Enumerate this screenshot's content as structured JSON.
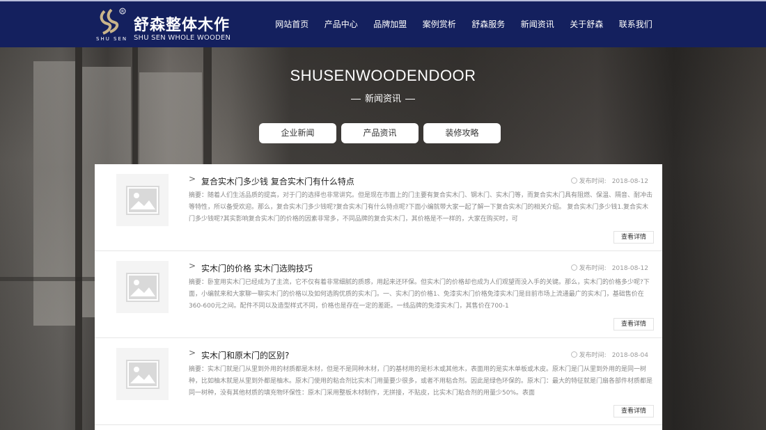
{
  "header": {
    "logo_cn": "舒森整体木作",
    "logo_en": "SHU SEN WHOLE WOODEN",
    "logo_mark_text": "SHU   SEN",
    "nav": [
      "网站首页",
      "产品中心",
      "品牌加盟",
      "案例赏析",
      "舒森服务",
      "新闻资讯",
      "关于舒森",
      "联系我们"
    ]
  },
  "hero": {
    "title": "SHUSENWOODENDOOR",
    "subtitle": "新闻资讯",
    "categories": [
      "企业新闻",
      "产品资讯",
      "装修攻略"
    ]
  },
  "news": {
    "date_label": "发布时间:",
    "more_label": "查看详情",
    "items": [
      {
        "title": "复合实木门多少钱 复合实木门有什么特点",
        "date": "2018-08-12",
        "summary": "摘要：随着人们生活品质的提高，对于门的选择也非常讲究。但是现在市面上的门主要有复合实木门、钢木门、实木门等，而复合实木门具有阻燃、保温、隔音、耐冲击等特性，所以备受欢迎。那么，复合实木门多少钱呢?复合实木门有什么特点呢?下面小编就带大家一起了解一下复合实木门的相关介绍。 复合实木门多少钱1.复合实木门多少钱呢?其实影响复合实木门的价格的因素非常多，不同品牌的复合实木门，其价格是不一样的，大家在购买时，可"
      },
      {
        "title": "实木门的价格 实木门选购技巧",
        "date": "2018-08-12",
        "summary": "摘要：卧室用实木门已经成为了主流，它不仅有着非常细腻的质感，用起来还环保。但实木门的价格却也成为人们观望而没入手的关键。那么，实木门的价格多少呢?下面，小编就来和大家聊一聊实木门的价格以及如何选购优质的实木门。一、实木门的价格1、免漆实木门价格免漆实木门是目前市场上流通最广的实木门，基础售价在360-600元之间。配件不同以及造型样式不同，价格也是存在一定的差距。一线品牌的免漆实木门，其售价在700-1"
      },
      {
        "title": "实木门和原木门的区别?",
        "date": "2018-08-04",
        "summary": "摘要：实木门就是门从里到外用的材质都是木材，但是不是同种木材，门的基材用的是杉木或其他木，表面用的是实木单板或木皮。原木门是门从里到外用的是同一树种，比如柚木就是从里到外都是柚木。原木门使用的粘合剂比实木门用量要少很多，或者不用粘合剂。因此是绿色环保的。原木门：最大的特征就是门扇各部件材质都是同一树种，没有其他材质的填充物环保性：原木门采用整板木材制作，无拼接，不贴皮，比实木门粘合剂的用量少50%。表面"
      }
    ]
  }
}
